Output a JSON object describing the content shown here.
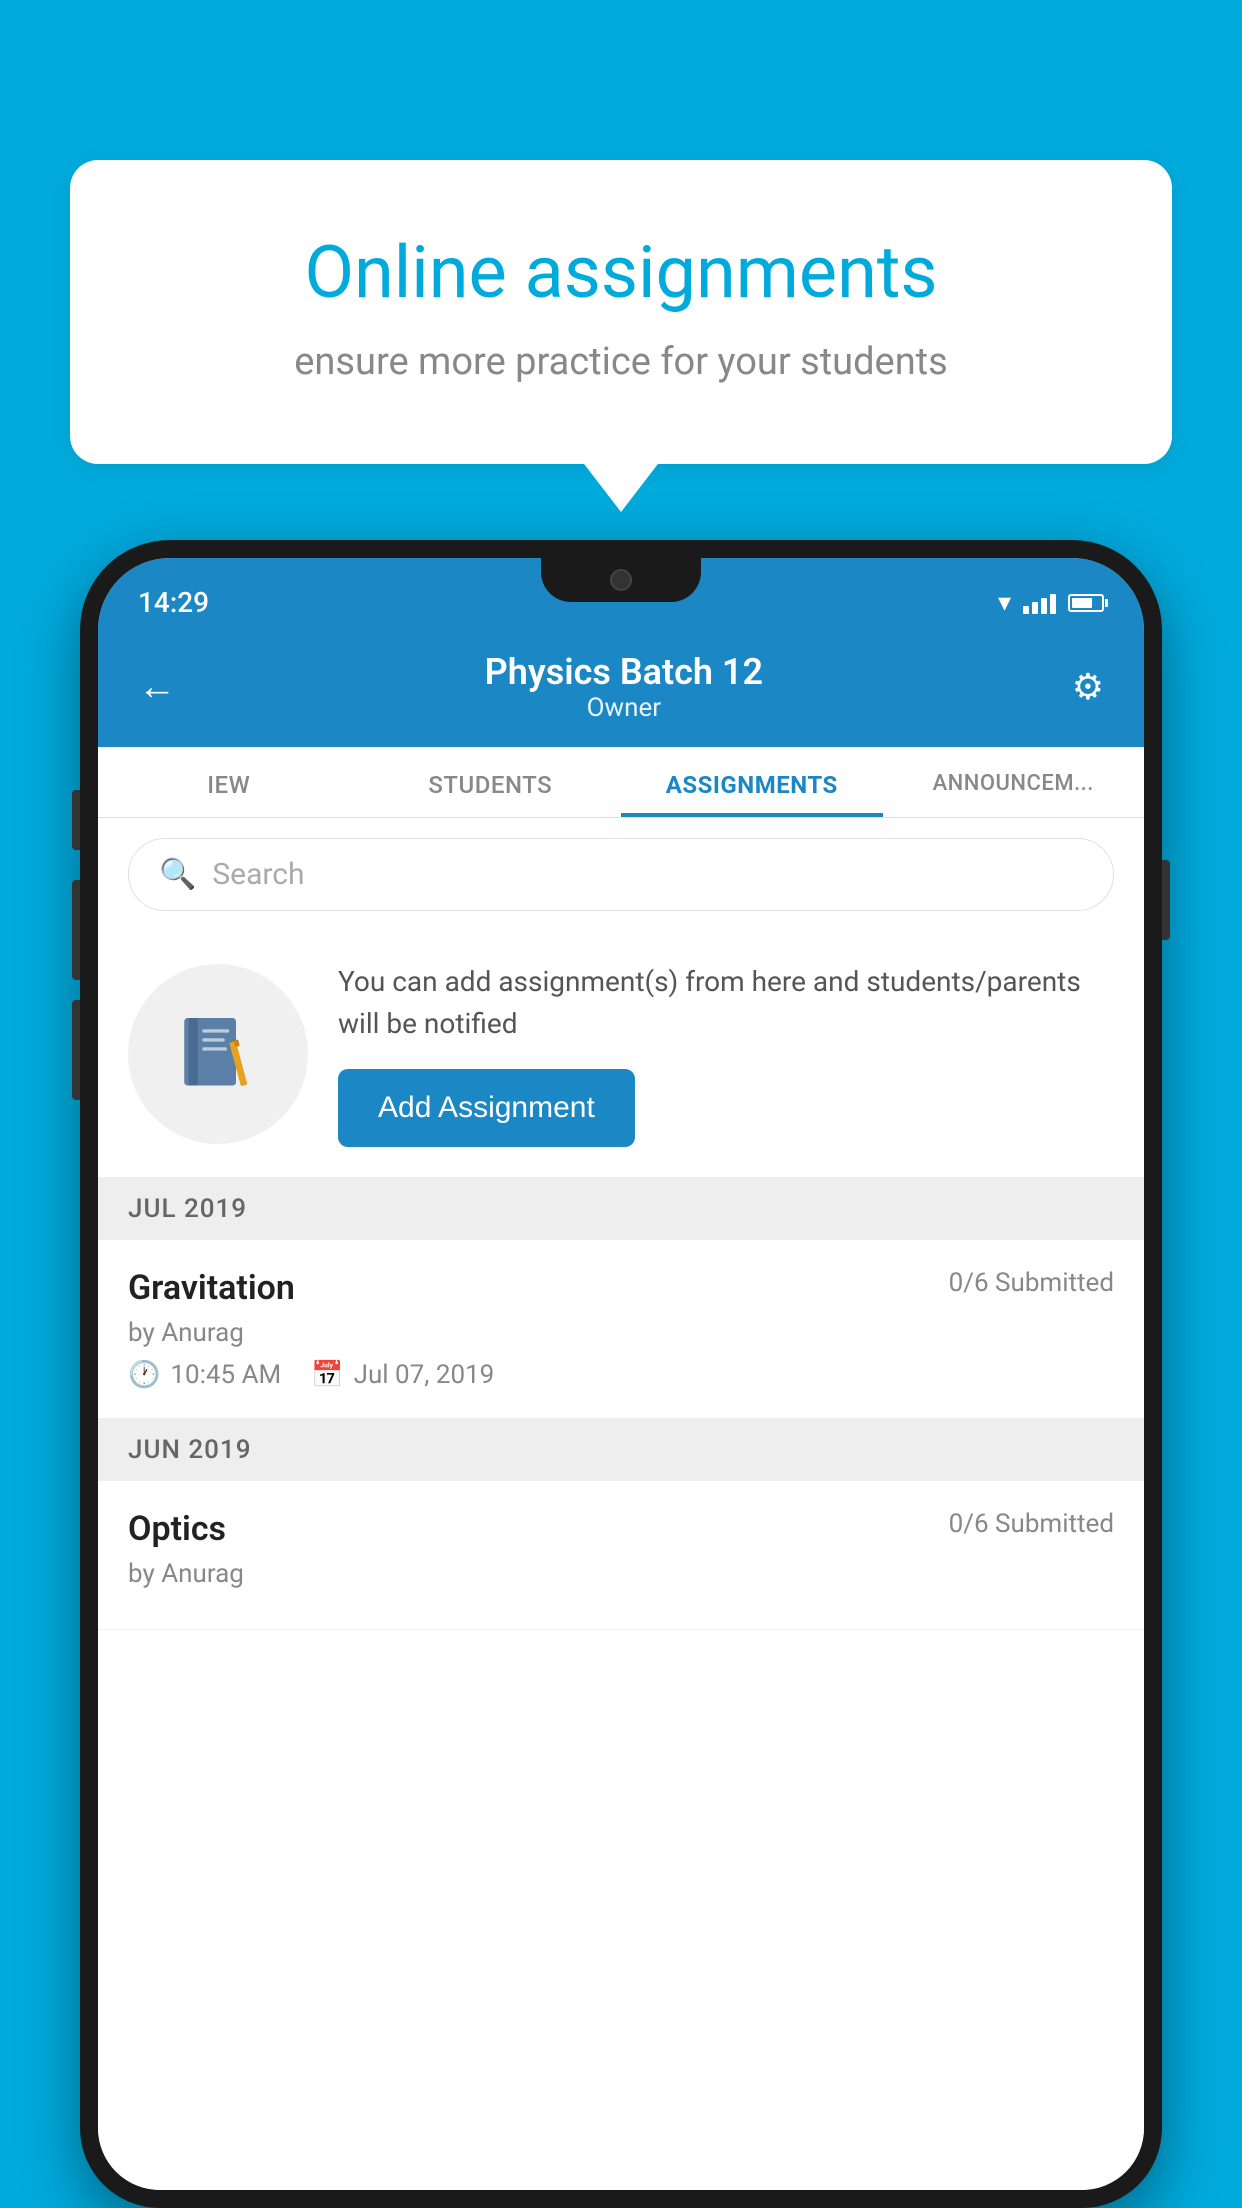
{
  "background_color": "#00AADD",
  "speech_bubble": {
    "title": "Online assignments",
    "subtitle": "ensure more practice for your students"
  },
  "status_bar": {
    "time": "14:29"
  },
  "app_header": {
    "title": "Physics Batch 12",
    "subtitle": "Owner",
    "back_label": "←",
    "settings_label": "⚙"
  },
  "tabs": [
    {
      "label": "IEW",
      "active": false
    },
    {
      "label": "STUDENTS",
      "active": false
    },
    {
      "label": "ASSIGNMENTS",
      "active": true
    },
    {
      "label": "ANNOUNCEM...",
      "active": false
    }
  ],
  "search": {
    "placeholder": "Search"
  },
  "promo": {
    "text": "You can add assignment(s) from here and students/parents will be notified",
    "button_label": "Add Assignment"
  },
  "sections": [
    {
      "header": "JUL 2019",
      "assignments": [
        {
          "name": "Gravitation",
          "status": "0/6 Submitted",
          "by": "by Anurag",
          "time": "10:45 AM",
          "date": "Jul 07, 2019"
        }
      ]
    },
    {
      "header": "JUN 2019",
      "assignments": [
        {
          "name": "Optics",
          "status": "0/6 Submitted",
          "by": "by Anurag",
          "time": "",
          "date": ""
        }
      ]
    }
  ]
}
